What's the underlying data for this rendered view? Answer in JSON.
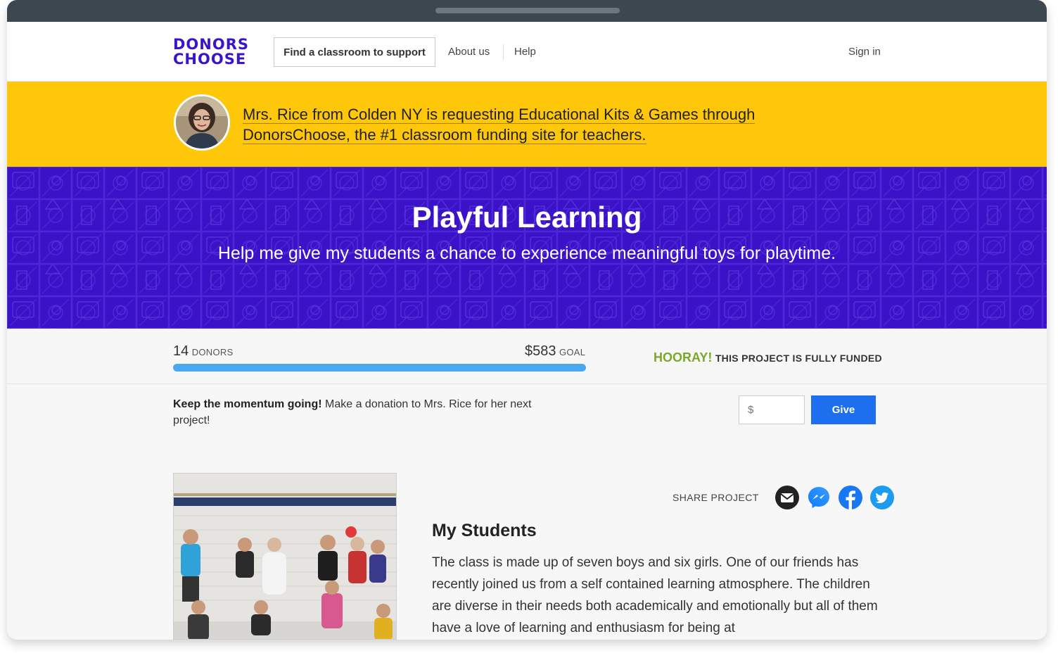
{
  "header": {
    "logo_line1": "DONORS",
    "logo_line2": "CHOOSE",
    "find_button": "Find a classroom to support",
    "about": "About us",
    "help": "Help",
    "signin": "Sign in"
  },
  "banner": {
    "line1": "Mrs. Rice from Colden NY is requesting Educational Kits & Games through",
    "line2": "DonorsChoose, the #1 classroom funding site for teachers."
  },
  "hero": {
    "title": "Playful Learning",
    "subtitle": "Help me give my students a chance to experience meaningful toys for playtime."
  },
  "stats": {
    "donors_count": "14",
    "donors_label": "DONORS",
    "goal_amount": "$583",
    "goal_label": "GOAL",
    "progress_fraction": 1.0,
    "hooray": "HOORAY!",
    "funded_text": "THIS PROJECT IS FULLY FUNDED"
  },
  "donation": {
    "bold": "Keep the momentum going!",
    "text": "Make a donation to Mrs. Rice for her next project!",
    "amount_placeholder": "$",
    "give_label": "Give"
  },
  "share": {
    "label": "SHARE PROJECT",
    "icons": [
      "email-icon",
      "messenger-icon",
      "facebook-icon",
      "twitter-icon"
    ]
  },
  "students": {
    "title": "My Students",
    "body": "The class is made up of seven boys and six girls. One of our friends has recently joined us from a self contained learning atmosphere. The children are diverse in their needs both academically and emotionally but all of them have a love of learning and enthusiasm for being at"
  },
  "colors": {
    "brand_purple": "#3b12c7",
    "banner_yellow": "#ffc70a",
    "progress_blue": "#4aa8f0",
    "give_blue": "#1e6ff0",
    "hooray_green": "#7ba828"
  }
}
